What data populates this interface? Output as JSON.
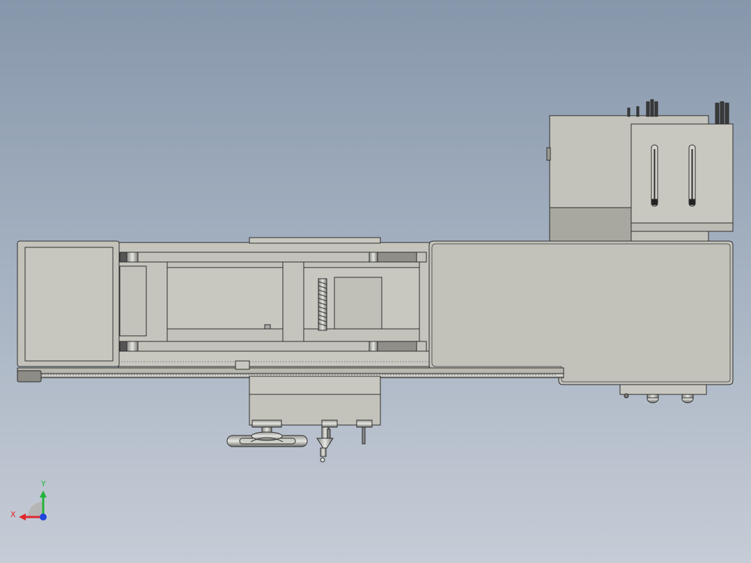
{
  "viewport": {
    "background_top": "#8797ab",
    "background_bottom": "#c6ccd6",
    "part_fill": "#c4c3bb",
    "part_edge": "#2b2b2b"
  },
  "triad": {
    "x_label": "X",
    "y_label": "Y",
    "x_color": "#e0252a",
    "y_color": "#22b33a",
    "z_color": "#2244dd"
  }
}
